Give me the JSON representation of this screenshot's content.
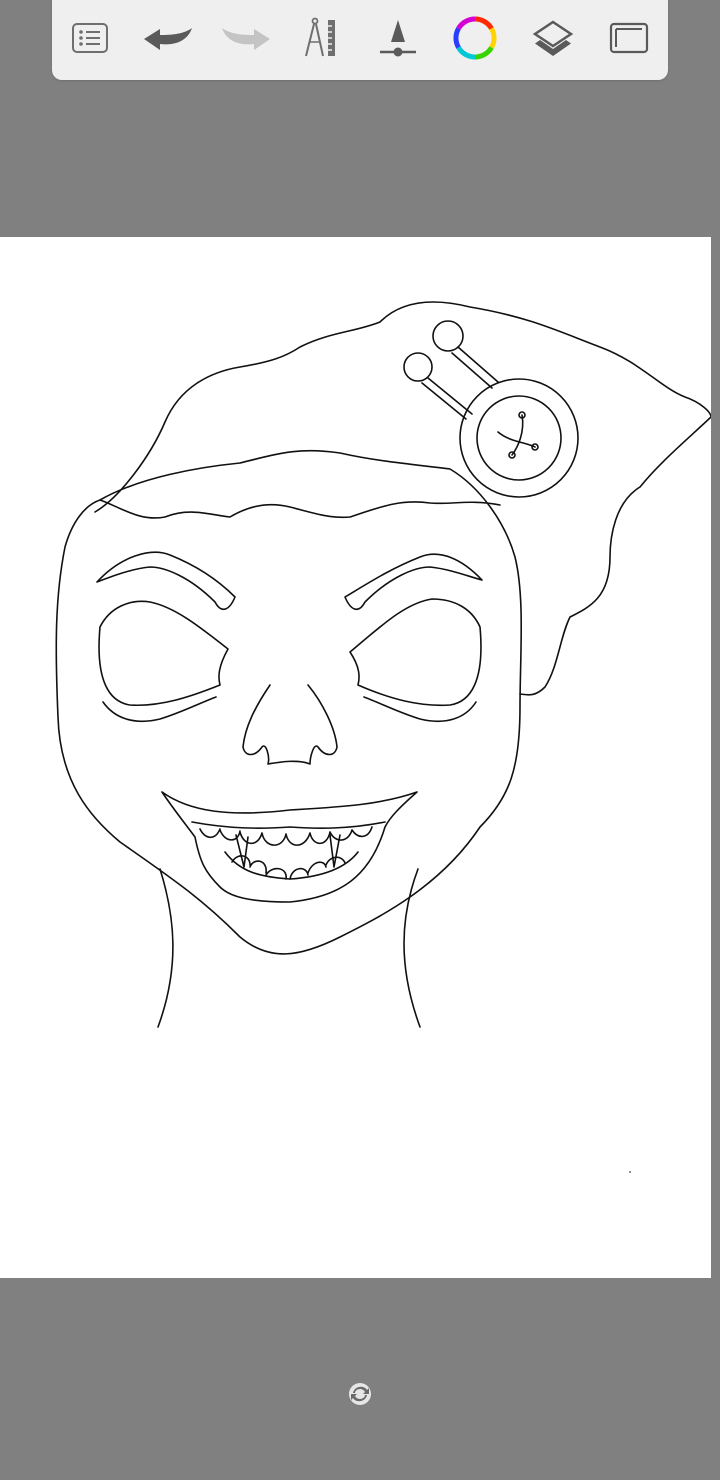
{
  "app": {
    "background_color": "#808080",
    "toolbar_color": "#efefef",
    "canvas_color": "#ffffff",
    "ink_color": "#111111"
  },
  "toolbar": {
    "tools": [
      {
        "name": "list-icon",
        "state": "enabled"
      },
      {
        "name": "undo-icon",
        "state": "enabled"
      },
      {
        "name": "redo-icon",
        "state": "disabled"
      },
      {
        "name": "ruler-compass-icon",
        "state": "enabled"
      },
      {
        "name": "brush-size-icon",
        "state": "enabled"
      },
      {
        "name": "color-wheel-icon",
        "state": "enabled"
      },
      {
        "name": "layers-icon",
        "state": "enabled"
      },
      {
        "name": "fullscreen-icon",
        "state": "enabled"
      }
    ]
  },
  "canvas": {
    "drawing": "line-art-face-with-hair-and-button-pin"
  },
  "bottom": {
    "handle_icon": "canvas-orientation-icon"
  }
}
